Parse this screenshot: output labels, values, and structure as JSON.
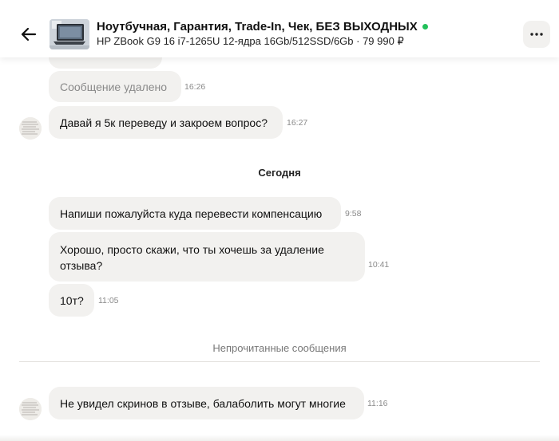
{
  "header": {
    "back_icon": "arrow-left-icon",
    "title": "Ноутбучная, Гарантия, Trade-In, Чек, БЕЗ ВЫХОДНЫХ",
    "subtitle": "HP ZBook G9 16 i7-1265U 12-ядра 16Gb/512SSD/6Gb · 79 990 ₽",
    "online_color": "#22c05a",
    "more_icon": "more-dots-icon"
  },
  "messages": [
    {
      "text": "Сообщение удалено",
      "time": "16:26",
      "deleted": true
    },
    {
      "text": "Давай я 5к переведу и закроем вопрос?",
      "time": "16:27"
    },
    {
      "text": "Напиши пожалуйста куда перевести компенсацию",
      "time": "9:58"
    },
    {
      "text": "Хорошо,  просто скажи, что ты хочешь за удаление отзыва?",
      "time": "10:41"
    },
    {
      "text": "10т?",
      "time": "11:05"
    },
    {
      "text": "Не увидел скринов в отзыве, балаболить могут многие",
      "time": "11:16"
    }
  ],
  "date_separator": "Сегодня",
  "unread_label": "Непрочитанные сообщения",
  "colors": {
    "bubble": "#f2f1ef",
    "deleted_text": "#8a8a8a",
    "time_text": "#8a8a8a"
  }
}
